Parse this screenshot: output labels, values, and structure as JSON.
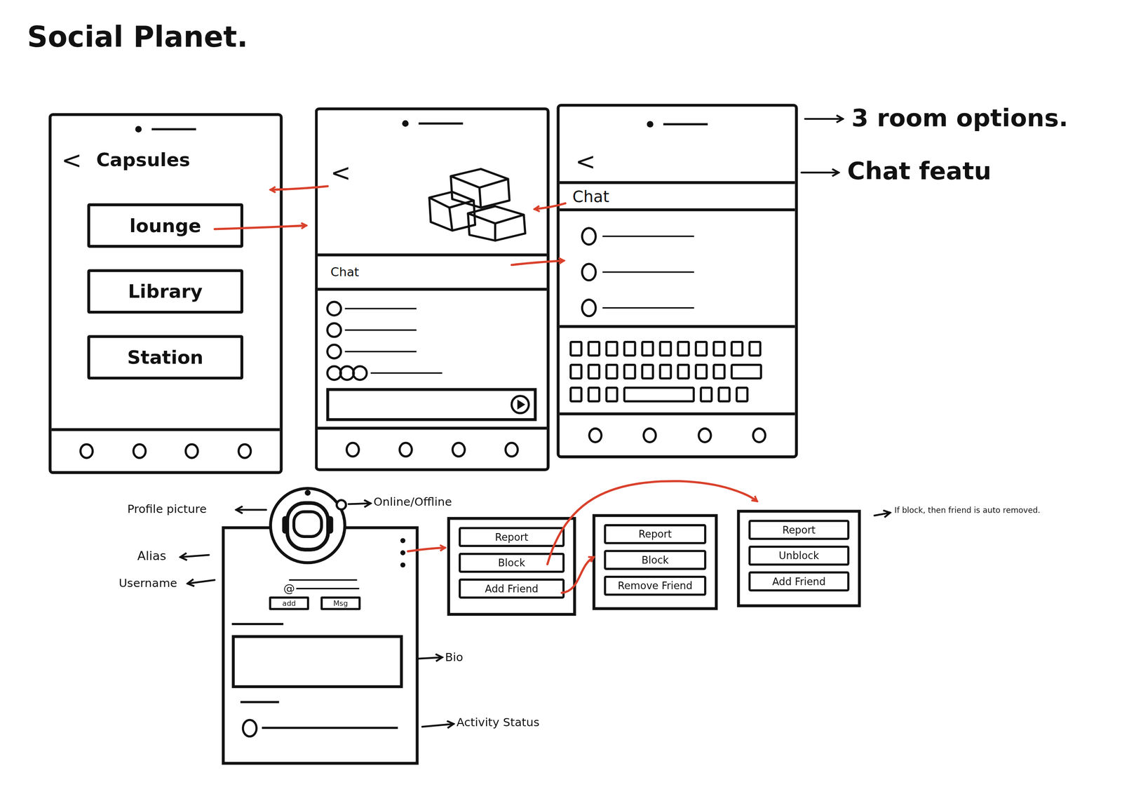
{
  "title": "Social Planet.",
  "room_options_note": "3 room options.",
  "chat_feature_note": "Chat featu",
  "capsules_screen": {
    "back": "<",
    "title": "Capsules",
    "rooms": [
      {
        "label": "lounge"
      },
      {
        "label": "Library"
      },
      {
        "label": "Station"
      }
    ]
  },
  "room_screen": {
    "back": "<",
    "chat_label": "Chat"
  },
  "chat_screen": {
    "back": "<",
    "chat_label": "Chat"
  },
  "profile": {
    "username_prefix": "@",
    "buttons": [
      "add",
      "Msg"
    ],
    "labels": {
      "profile_picture": "Profile picture",
      "online": "Online/Offline",
      "alias": "Alias",
      "username": "Username",
      "bio": "Bio",
      "activity": "Activity Status"
    }
  },
  "menus": [
    {
      "items": [
        "Report",
        "Block",
        "Add Friend"
      ]
    },
    {
      "items": [
        "Report",
        "Block",
        "Remove Friend"
      ]
    },
    {
      "items": [
        "Report",
        "Unblock",
        "Add Friend"
      ]
    }
  ],
  "note": "If block, then friend is auto removed."
}
